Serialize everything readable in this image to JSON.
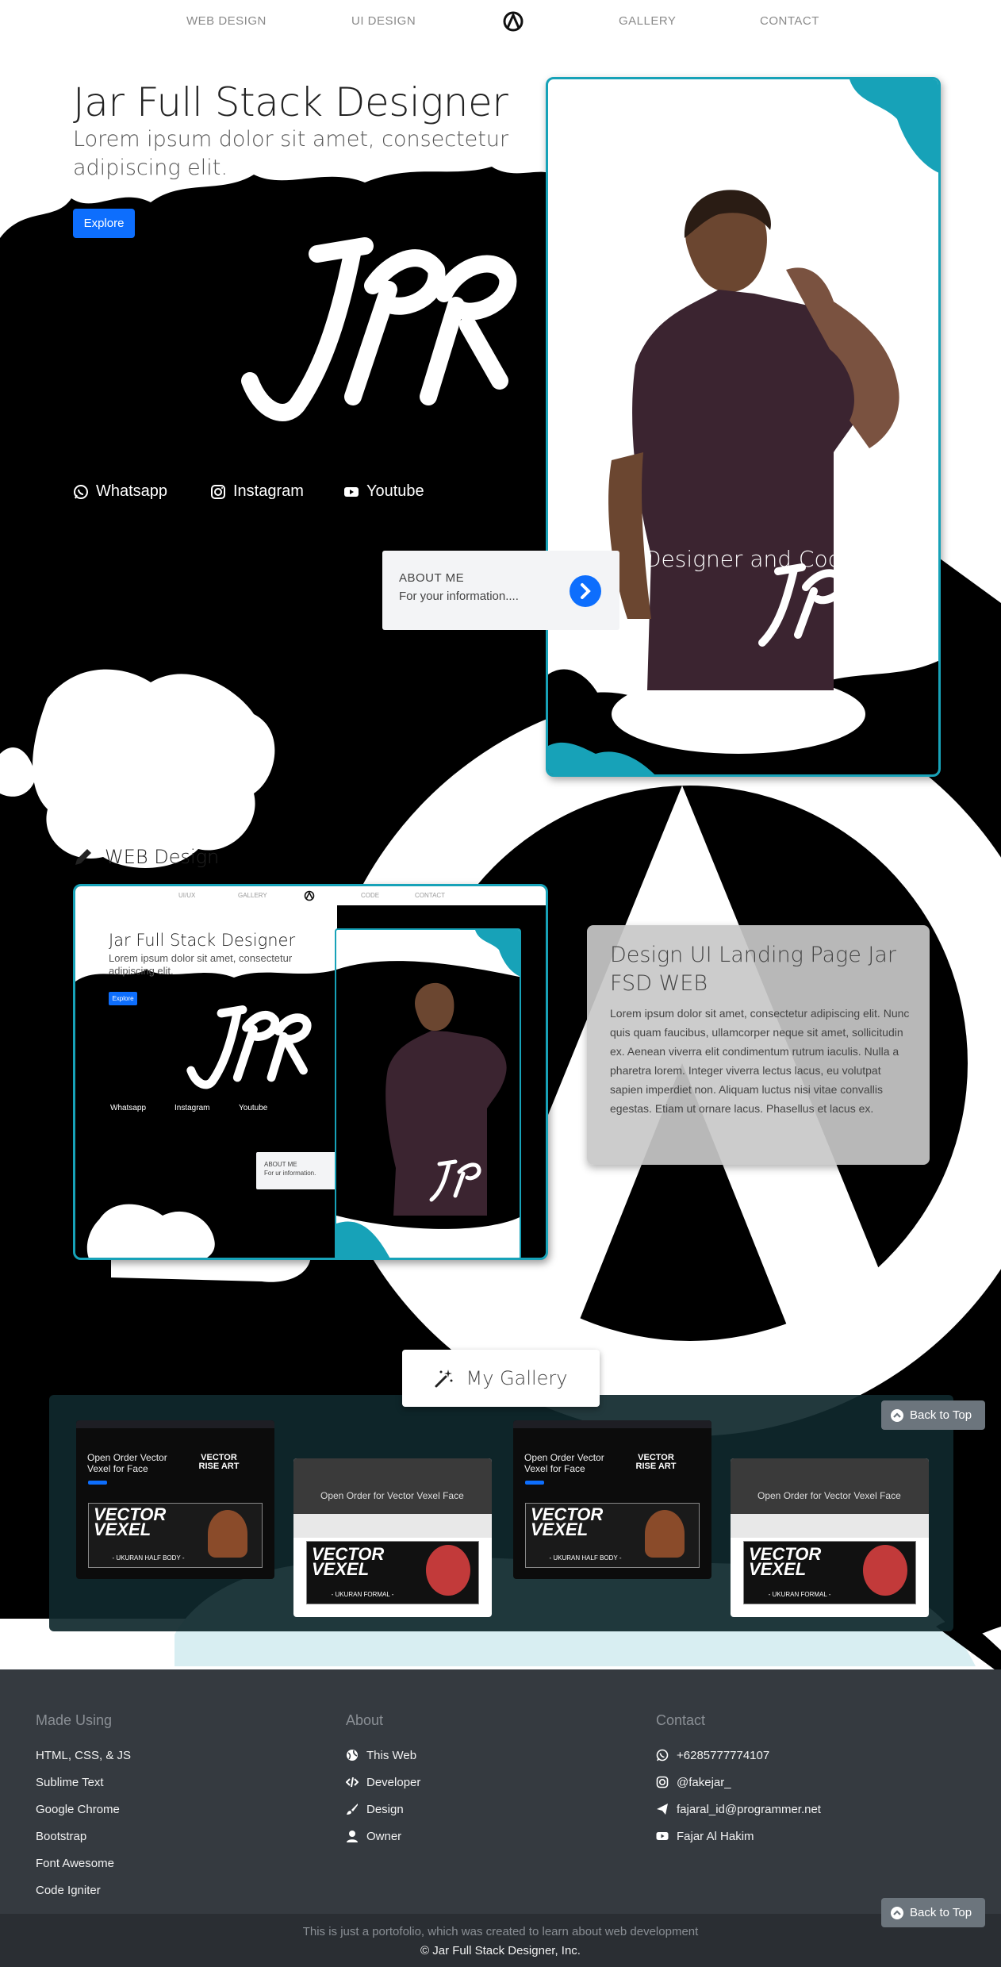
{
  "nav": {
    "items": [
      "WEB DESIGN",
      "UI DESIGN",
      "GALLERY",
      "CONTACT"
    ],
    "logo_icon": "jar-logo-icon"
  },
  "hero": {
    "title": "Jar Full Stack Designer",
    "subtitle": "Lorem ipsum dolor sit amet, consectetur adipiscing elit.",
    "explore_label": "Explore",
    "socials": [
      {
        "label": "Whatsapp",
        "icon": "whatsapp-icon"
      },
      {
        "label": "Instagram",
        "icon": "instagram-icon"
      },
      {
        "label": "Youtube",
        "icon": "youtube-icon"
      }
    ],
    "about_card": {
      "title": "ABOUT ME",
      "text": "For your information....",
      "icon": "chevron-right-icon"
    },
    "photo_caption": "Designer and Coder"
  },
  "web_design": {
    "heading": "WEB Design",
    "heading_icon": "pencil-icon",
    "preview": {
      "nav": [
        "UI/UX",
        "GALLERY",
        "CODE",
        "CONTACT"
      ],
      "title": "Jar Full Stack Designer",
      "subtitle": "Lorem ipsum dolor sit amet, consectetur adipiscing elit.",
      "explore_label": "Explore",
      "socials": [
        "Whatsapp",
        "Instagram",
        "Youtube"
      ],
      "about_title": "ABOUT ME",
      "about_text": "For ur information."
    },
    "card": {
      "title": "Design UI Landing Page Jar FSD WEB",
      "body": "Lorem ipsum dolor sit amet, consectetur adipiscing elit. Nunc quis quam faucibus, ullamcorper neque sit amet, sollicitudin ex. Aenean viverra elit condimentum rutrum iaculis. Nulla a pharetra lorem. Integer viverra lectus lacus, eu volutpat sapien imperdiet non. Aliquam luctus nisi vitae convallis egestas. Etiam ut ornare lacus. Phasellus et lacus ex."
    }
  },
  "gallery": {
    "heading": "My Gallery",
    "heading_icon": "magic-wand-icon",
    "items": [
      {
        "caption": "Open Order Vector Vexel for Face",
        "banner": "VECTOR VEXEL",
        "tag": "- UKURAN HALF BODY -",
        "side": "VECTOR RISE ART"
      },
      {
        "caption": "Open Order for Vector Vexel Face",
        "banner": "VECTOR VEXEL",
        "tag": "- UKURAN FORMAL -"
      },
      {
        "caption": "Open Order Vector Vexel for Face",
        "banner": "VECTOR VEXEL",
        "tag": "- UKURAN HALF BODY -",
        "side": "VECTOR RISE ART"
      },
      {
        "caption": "Open Order for Vector Vexel Face",
        "banner": "VECTOR VEXEL",
        "tag": "- UKURAN FORMAL -"
      }
    ]
  },
  "back_to_top": "Back to Top",
  "footer": {
    "made_using": {
      "heading": "Made Using",
      "items": [
        "HTML, CSS, & JS",
        "Sublime Text",
        "Google Chrome",
        "Bootstrap",
        "Font Awesome",
        "Code Igniter"
      ]
    },
    "about": {
      "heading": "About",
      "items": [
        {
          "label": "This Web",
          "icon": "globe-icon"
        },
        {
          "label": "Developer",
          "icon": "code-icon"
        },
        {
          "label": "Design",
          "icon": "brush-icon"
        },
        {
          "label": "Owner",
          "icon": "user-icon"
        }
      ]
    },
    "contact": {
      "heading": "Contact",
      "items": [
        {
          "label": "+6285777774107",
          "icon": "whatsapp-icon"
        },
        {
          "label": "@fakejar_",
          "icon": "instagram-icon"
        },
        {
          "label": "fajaral_id@programmer.net",
          "icon": "paper-plane-icon"
        },
        {
          "label": "Fajar Al Hakim",
          "icon": "youtube-icon"
        }
      ]
    },
    "note": "This is just a portofolio, which was created to learn about web development",
    "copyright": "© Jar Full Stack Designer, Inc."
  },
  "colors": {
    "accent": "#17a2b8",
    "primary": "#0d6efd",
    "footer": "#353a40"
  }
}
